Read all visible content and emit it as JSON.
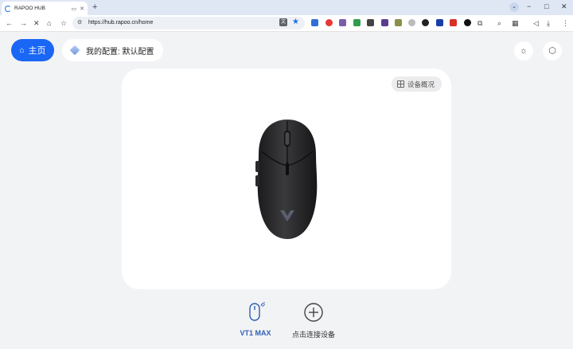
{
  "browser": {
    "tab_title": "RAPOO HUB",
    "url": "https://hub.rapoo.cn/home",
    "window_controls": [
      "−",
      "□",
      "✕"
    ]
  },
  "app": {
    "home_label": "主页",
    "config_label": "我的配置: 默认配置",
    "overview_label": "设备概况",
    "devices": [
      {
        "name": "VT1 MAX",
        "icon": "mouse-wireless-icon",
        "active": true
      },
      {
        "name": "点击连接设备",
        "icon": "plus-circle-icon",
        "active": false
      }
    ]
  },
  "colors": {
    "accent": "#1a66f5",
    "active_device_text": "#2f5fb8",
    "background": "#f2f3f5"
  }
}
